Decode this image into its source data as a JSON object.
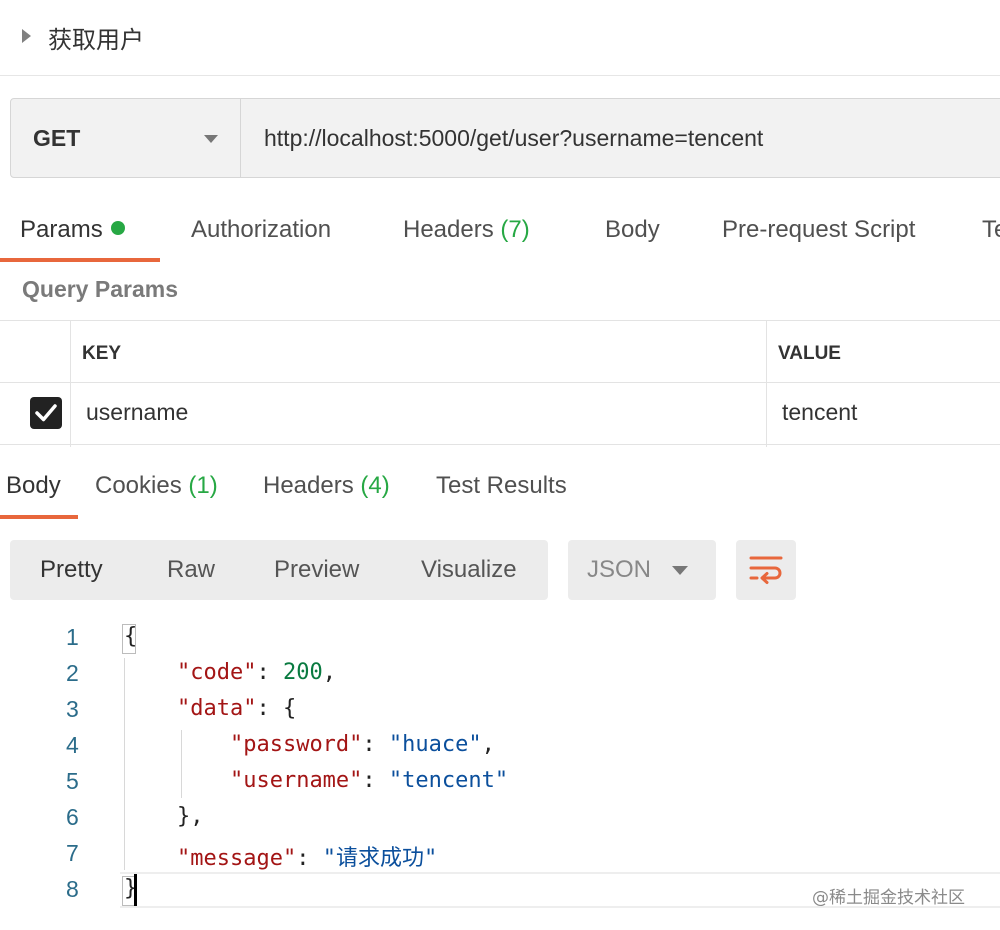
{
  "request": {
    "name": "获取用户"
  },
  "urlbar": {
    "method": "GET",
    "url": "http://localhost:5000/get/user?username=tencent"
  },
  "request_tabs": [
    {
      "label": "Params",
      "active": true
    },
    {
      "label": "Authorization"
    },
    {
      "label": "Headers",
      "count": "(7)"
    },
    {
      "label": "Body"
    },
    {
      "label": "Pre-request Script"
    },
    {
      "label": "Te"
    }
  ],
  "query_params": {
    "title": "Query Params",
    "columns": {
      "key": "KEY",
      "value": "VALUE"
    },
    "rows": [
      {
        "checked": true,
        "key": "username",
        "value": "tencent"
      }
    ]
  },
  "response_tabs": [
    {
      "label": "Body",
      "active": true
    },
    {
      "label": "Cookies",
      "count": "(1)"
    },
    {
      "label": "Headers",
      "count": "(4)"
    },
    {
      "label": "Test Results"
    }
  ],
  "view_modes": [
    "Pretty",
    "Raw",
    "Preview",
    "Visualize"
  ],
  "format": {
    "selected": "JSON"
  },
  "wrap_icon": "wrap-lines-icon",
  "code": {
    "line_numbers": [
      "1",
      "2",
      "3",
      "4",
      "5",
      "6",
      "7",
      "8"
    ],
    "tokens": {
      "open_brace": "{",
      "code_key": "\"code\"",
      "code_val": "200",
      "data_key": "\"data\"",
      "password_key": "\"password\"",
      "password_val": "\"huace\"",
      "username_key": "\"username\"",
      "username_val": "\"tencent\"",
      "close_data": "},",
      "message_key": "\"message\"",
      "message_val": "\"请求成功\"",
      "close_brace": "}"
    }
  },
  "watermark": "@稀土掘金技术社区",
  "colors": {
    "accent": "#e8673c",
    "active_dot": "#27a844",
    "count": "#27a844"
  }
}
